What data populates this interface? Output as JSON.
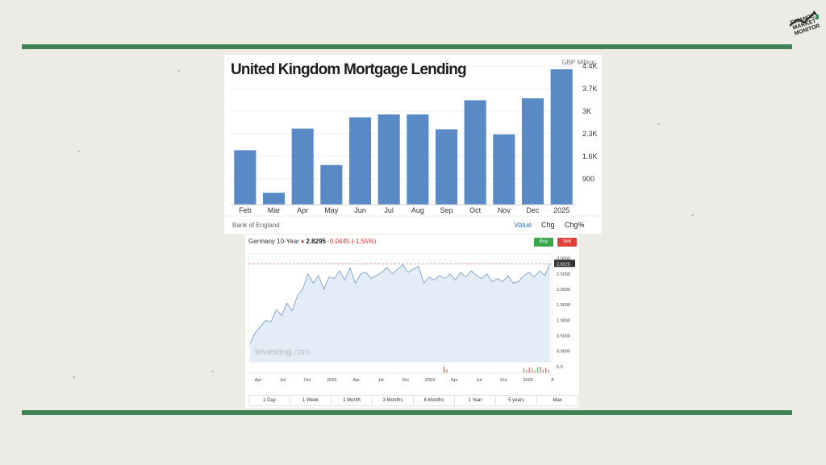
{
  "logo": {
    "lines": [
      "FINANCE",
      "MARKET",
      "MONITOR"
    ]
  },
  "colors": {
    "rule": "#3e8457",
    "bar": "#5a8ac6",
    "line": "#8aa9c9",
    "area": "#e3edf8"
  },
  "mortgage": {
    "title": "United Kingdom Mortgage Lending",
    "unit": "GBP Million",
    "source": "Bank of England",
    "tabs": [
      "Value",
      "Chg",
      "Chg%"
    ],
    "active_tab": "Value"
  },
  "bund": {
    "name": "Germany 10-Year",
    "price": "2.8295",
    "change": "-0.0445",
    "change_pct": "(-1.55%)",
    "last_label": "2.8225",
    "buy": "Buy",
    "sell": "Sell",
    "watermark_a": "Investing",
    "watermark_b": ".com",
    "ranges": [
      "1 Day",
      "1 Week",
      "1 Month",
      "3 Months",
      "6 Months",
      "1 Year",
      "5 years",
      "Max"
    ]
  },
  "chart_data": [
    {
      "type": "bar",
      "title": "United Kingdom Mortgage Lending",
      "ylabel": "GBP Million",
      "categories": [
        "Feb",
        "Mar",
        "Apr",
        "May",
        "Jun",
        "Jul",
        "Aug",
        "Sep",
        "Oct",
        "Nov",
        "Dec",
        "2025"
      ],
      "values": [
        1790,
        470,
        2460,
        1330,
        2810,
        2900,
        2900,
        2440,
        3340,
        2280,
        3400,
        4300
      ],
      "yticks": [
        900,
        1600,
        2300,
        3000,
        3700,
        4400
      ],
      "ytick_labels": [
        "900",
        "1.6K",
        "2.3K",
        "3K",
        "3.7K",
        "4.4K"
      ],
      "ylim": [
        100,
        4400
      ],
      "axis_position": "right"
    },
    {
      "type": "area",
      "title": "Germany 10-Year",
      "x_labels": [
        "Apr",
        "Jul",
        "Oct",
        "2023",
        "Apr",
        "Jul",
        "Oct",
        "2024",
        "Apr",
        "Jul",
        "Oct",
        "2025",
        "A"
      ],
      "yticks": [
        0.0,
        0.5,
        1.0,
        1.5,
        2.0,
        2.5,
        3.0
      ],
      "ytick_labels": [
        "0.0000",
        "0.5000",
        "1.0000",
        "1.5000",
        "2.0000",
        "2.5000",
        "3.0000"
      ],
      "ylim": [
        -0.35,
        3.15
      ],
      "reference_line": 2.8295,
      "volume_axis_label": "5.0",
      "values": [
        0.25,
        0.6,
        0.8,
        1.0,
        0.95,
        1.35,
        1.15,
        1.55,
        1.3,
        1.8,
        2.0,
        2.5,
        2.2,
        2.45,
        2.0,
        2.4,
        2.35,
        2.6,
        2.3,
        2.7,
        2.2,
        2.5,
        2.55,
        2.35,
        2.45,
        2.55,
        2.7,
        2.5,
        2.65,
        2.8,
        2.55,
        2.65,
        2.75,
        2.2,
        2.4,
        2.3,
        2.45,
        2.35,
        2.5,
        2.3,
        2.55,
        2.4,
        2.6,
        2.45,
        2.35,
        2.5,
        2.25,
        2.35,
        2.25,
        2.45,
        2.2,
        2.25,
        2.45,
        2.55,
        2.4,
        2.6,
        2.45,
        2.8295
      ],
      "volume_bars": [
        1.0,
        0.6,
        0.8,
        0.5,
        0.9,
        0.7,
        0.4,
        0.9,
        1.0,
        0.6,
        0.8,
        0.5
      ]
    }
  ]
}
